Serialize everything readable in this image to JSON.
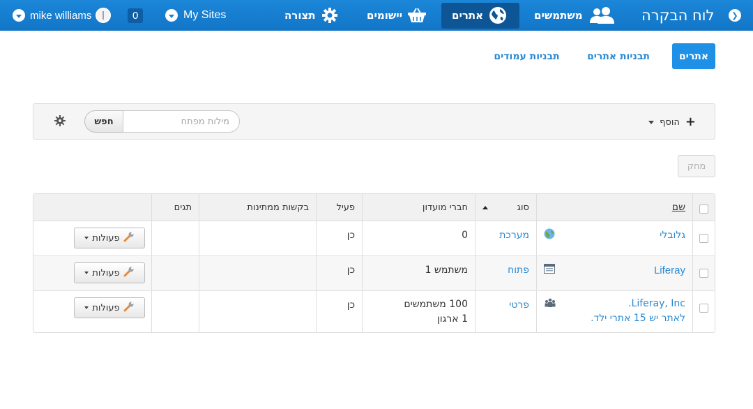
{
  "topbar": {
    "user_name": "mike williams",
    "notifications_count": "0",
    "my_sites_label": "My Sites",
    "configuration_label": "תצורה",
    "apps_label": "יישומים",
    "sites_label": "אתרים",
    "users_label": "משתמשים",
    "home_title": "לוח הבקרה"
  },
  "subnav": {
    "sites_tab": "אתרים",
    "site_templates_tab": "תבניות אתרים",
    "page_templates_tab": "תבניות עמודים"
  },
  "toolbar": {
    "add_label": "הוסף",
    "search_placeholder": "מילות מפתח",
    "search_button": "חפש"
  },
  "delete_label": "מחק",
  "table": {
    "headers": {
      "name": "שם",
      "type": "סוג",
      "members": "חברי מועדון",
      "active": "פעיל",
      "pending_requests": "בקשות ממתינות",
      "tags": "תגים"
    },
    "rows": [
      {
        "name": "גלובלי",
        "type": "מערכת",
        "members": "0",
        "active": "כן",
        "actions_label": "פעולות",
        "type_icon": "globe-icon"
      },
      {
        "name": "Liferay",
        "type": "פתוח",
        "members": "משתמש 1",
        "active": "כן",
        "actions_label": "פעולות",
        "type_icon": "site-page-icon"
      },
      {
        "name": "Liferay, Inc.",
        "sub_text": "לאתר יש 15 אתרי ילד.",
        "type": "פרטי",
        "members": "100 משתמשים",
        "members_line2": "1 ארגון",
        "active": "כן",
        "actions_label": "פעולות",
        "type_icon": "organization-icon"
      }
    ]
  },
  "colors": {
    "topbar": "#1a7fd2",
    "link": "#2a8ad3",
    "active_tab": "#1e90e6"
  }
}
